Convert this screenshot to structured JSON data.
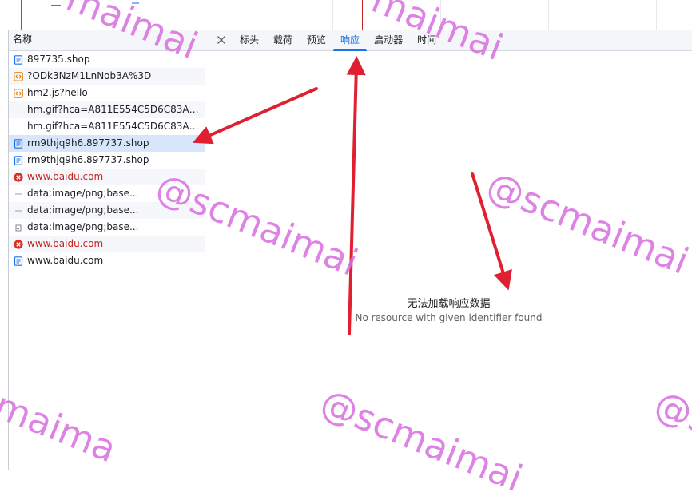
{
  "request_list": {
    "header": "名称",
    "items": [
      {
        "name": "897735.shop",
        "icon": "document-icon",
        "status": "ok"
      },
      {
        "name": "?ODk3NzM1LnNob3A%3D",
        "icon": "script-icon",
        "status": "ok"
      },
      {
        "name": "hm2.js?hello",
        "icon": "script-icon",
        "status": "ok"
      },
      {
        "name": "hm.gif?hca=A811E554C5D6C83A&c...",
        "icon": "none",
        "status": "ok"
      },
      {
        "name": "hm.gif?hca=A811E554C5D6C83A&c...",
        "icon": "none",
        "status": "ok"
      },
      {
        "name": "rm9thjq9h6.897737.shop",
        "icon": "document-icon",
        "status": "ok",
        "selected": true
      },
      {
        "name": "rm9thjq9h6.897737.shop",
        "icon": "document-icon",
        "status": "ok"
      },
      {
        "name": "www.baidu.com",
        "icon": "error-icon",
        "status": "error"
      },
      {
        "name": "data:image/png;base...",
        "icon": "image-dash-icon",
        "status": "ok"
      },
      {
        "name": "data:image/png;base...",
        "icon": "image-dash-icon",
        "status": "ok"
      },
      {
        "name": "data:image/png;base...",
        "icon": "image-file-icon",
        "status": "ok"
      },
      {
        "name": "www.baidu.com",
        "icon": "error-icon",
        "status": "error"
      },
      {
        "name": "www.baidu.com",
        "icon": "document-icon",
        "status": "ok"
      }
    ]
  },
  "detail_tabs": {
    "close_icon": "close-icon",
    "items": [
      {
        "label": "标头",
        "active": false
      },
      {
        "label": "载荷",
        "active": false
      },
      {
        "label": "预览",
        "active": false
      },
      {
        "label": "响应",
        "active": true
      },
      {
        "label": "启动器",
        "active": false
      },
      {
        "label": "时间",
        "active": false
      }
    ]
  },
  "response_panel": {
    "empty_title": "无法加载响应数据",
    "empty_subtitle": "No resource with given identifier found"
  },
  "watermark": {
    "text": "@scmaimai",
    "partial_text": "maimai",
    "partial_text_2": "maimai",
    "partial_text_3": "maima",
    "partial_text_4": "@s",
    "partial_text_5": "@scmaimai",
    "color": "#d86ee0"
  },
  "annotation": {
    "arrow_color": "#e02030"
  },
  "colors": {
    "accent": "#1a73e8",
    "error": "#c5221f",
    "selected_row": "#d8e6fb"
  }
}
